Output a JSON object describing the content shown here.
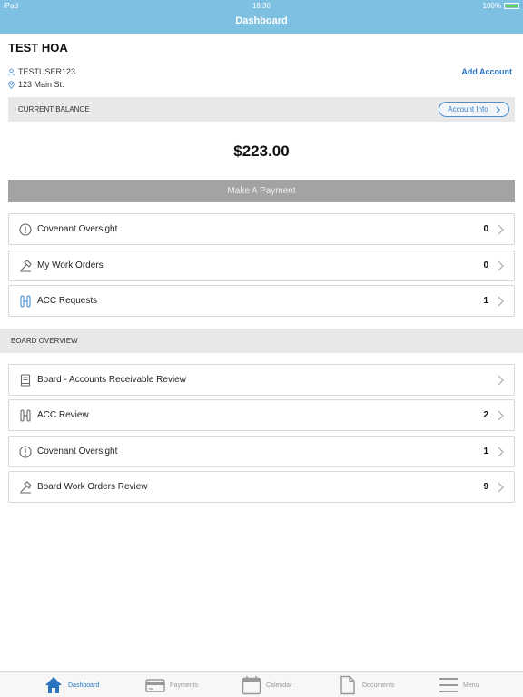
{
  "status_bar": {
    "device": "iPad",
    "time": "18:30",
    "battery": "100%"
  },
  "header": {
    "title": "Dashboard"
  },
  "account": {
    "hoa_name": "TEST HOA",
    "username": "TESTUSER123",
    "address": "123 Main St.",
    "add_account_label": "Add Account"
  },
  "balance": {
    "label": "CURRENT BALANCE",
    "account_info_label": "Account Info",
    "amount": "$223.00",
    "pay_label": "Make A Payment"
  },
  "my_items": [
    {
      "label": "Covenant  Oversight",
      "count": "0",
      "icon": "alert-circle-icon"
    },
    {
      "label": "My Work Orders",
      "count": "0",
      "icon": "hammer-icon"
    },
    {
      "label": "ACC Requests",
      "count": "1",
      "icon": "acc-icon"
    }
  ],
  "board": {
    "label": "BOARD OVERVIEW",
    "items": [
      {
        "label": "Board - Accounts Receivable Review",
        "count": "",
        "icon": "book-icon"
      },
      {
        "label": "ACC Review",
        "count": "2",
        "icon": "acc-icon"
      },
      {
        "label": "Covenant Oversight",
        "count": "1",
        "icon": "alert-circle-icon"
      },
      {
        "label": "Board Work Orders Review",
        "count": "9",
        "icon": "hammer-icon"
      }
    ]
  },
  "tabbar": {
    "tabs": [
      {
        "label": "Dashboard",
        "icon": "home-icon",
        "active": true
      },
      {
        "label": "Payments",
        "icon": "credit-card-icon",
        "active": false
      },
      {
        "label": "Calendar",
        "icon": "calendar-icon",
        "active": false
      },
      {
        "label": "Documents",
        "icon": "document-icon",
        "active": false
      },
      {
        "label": "Menu",
        "icon": "menu-icon",
        "active": false
      }
    ]
  },
  "colors": {
    "header": "#7ec0e2",
    "accent": "#2a74c0",
    "pay_button": "#a3a3a3"
  }
}
